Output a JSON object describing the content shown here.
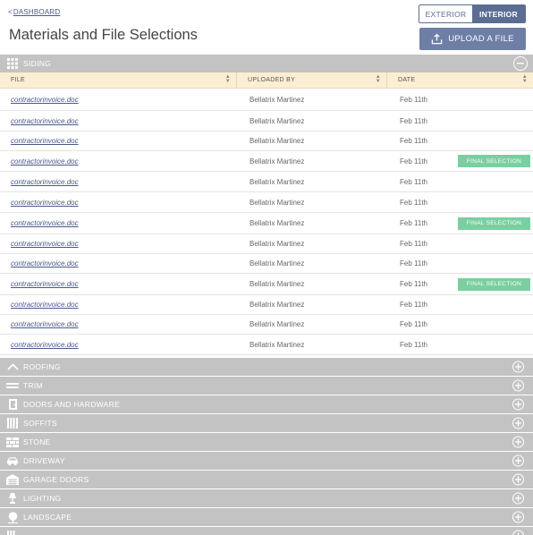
{
  "header": {
    "back_chevron": "<",
    "back_label": "DASHBOARD",
    "title": "Materials and File Selections",
    "view_toggle": {
      "exterior_label": "EXTERIOR",
      "interior_label": "INTERIOR",
      "selected": "INTERIOR"
    },
    "upload_label": "UPLOAD A FILE"
  },
  "expanded_section": {
    "name": "SIDING",
    "icon": "siding-grid-icon",
    "toggle_icon": "collapse-minus-icon",
    "columns": {
      "file": "FILE",
      "uploaded_by": "UPLOADED BY",
      "date": "DATE"
    },
    "rows": [
      {
        "file": "contractorinvoice.doc",
        "uploaded_by": "Bellatrix Martinez",
        "date": "Feb 11th",
        "badge": ""
      },
      {
        "file": "contractorinvoice.doc",
        "uploaded_by": "Bellatrix Martinez",
        "date": "Feb 11th",
        "badge": ""
      },
      {
        "file": "contractorinvoice.doc",
        "uploaded_by": "Bellatrix Martinez",
        "date": "Feb 11th",
        "badge": ""
      },
      {
        "file": "contractorinvoice.doc",
        "uploaded_by": "Bellatrix Martinez",
        "date": "Feb 11th",
        "badge": "FINAL SELECTION"
      },
      {
        "file": "contractorinvoice.doc",
        "uploaded_by": "Bellatrix Martinez",
        "date": "Feb 11th",
        "badge": ""
      },
      {
        "file": "contractorinvoice.doc",
        "uploaded_by": "Bellatrix Martinez",
        "date": "Feb 11th",
        "badge": ""
      },
      {
        "file": "contractorinvoice.doc",
        "uploaded_by": "Bellatrix Martinez",
        "date": "Feb 11th",
        "badge": "FINAL SELECTION"
      },
      {
        "file": "contractorinvoice.doc",
        "uploaded_by": "Bellatrix Martinez",
        "date": "Feb 11th",
        "badge": ""
      },
      {
        "file": "contractorinvoice.doc",
        "uploaded_by": "Bellatrix Martinez",
        "date": "Feb 11th",
        "badge": ""
      },
      {
        "file": "contractorinvoice.doc",
        "uploaded_by": "Bellatrix Martinez",
        "date": "Feb 11th",
        "badge": "FINAL SELECTION"
      },
      {
        "file": "contractorinvoice.doc",
        "uploaded_by": "Bellatrix Martinez",
        "date": "Feb 11th",
        "badge": ""
      },
      {
        "file": "contractorinvoice.doc",
        "uploaded_by": "Bellatrix Martinez",
        "date": "Feb 11th",
        "badge": ""
      },
      {
        "file": "contractorinvoice.doc",
        "uploaded_by": "Bellatrix Martinez",
        "date": "Feb 11th",
        "badge": ""
      }
    ]
  },
  "collapsed_sections": [
    {
      "name": "ROOFING",
      "icon": "roof-icon"
    },
    {
      "name": "TRIM",
      "icon": "trim-icon"
    },
    {
      "name": "DOORS AND HARDWARE",
      "icon": "door-icon"
    },
    {
      "name": "SOFFITS",
      "icon": "soffits-icon"
    },
    {
      "name": "STONE",
      "icon": "stone-icon"
    },
    {
      "name": "DRIVEWAY",
      "icon": "car-icon"
    },
    {
      "name": "GARAGE DOORS",
      "icon": "garage-icon"
    },
    {
      "name": "LIGHTING",
      "icon": "lamp-icon"
    },
    {
      "name": "LANDSCAPE",
      "icon": "tree-icon"
    },
    {
      "name": "",
      "icon": "partial-section-icon"
    }
  ],
  "colors": {
    "accent": "#5c6d94",
    "upload_button": "#6e7fa6",
    "section_bar": "#c3c3c3",
    "column_header": "#fbeed2",
    "final_badge": "#79cfa0",
    "link": "#4a5a8a"
  }
}
